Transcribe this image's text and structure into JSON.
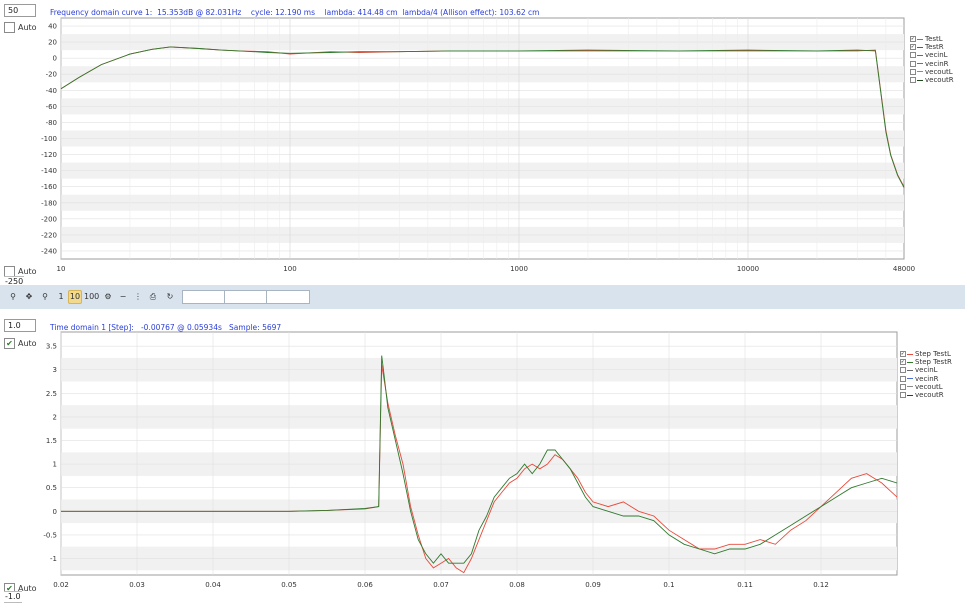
{
  "top": {
    "max_value": "50",
    "auto_label": "Auto",
    "auto_checked": false,
    "bottom_auto_label": "Auto",
    "bottom_auto_checked": false,
    "min_value": "-250",
    "title": "Frequency domain curve 1:  15.353dB @ 82.031Hz    cycle: 12.190 ms    lambda: 414.48 cm  lambda/4 (Allison effect): 103.62 cm"
  },
  "bottom": {
    "max_value": "1.0",
    "auto_label": "Auto",
    "auto_checked": true,
    "bottom_auto_label": "Auto",
    "bottom_auto_checked": true,
    "min_value": "-1.0",
    "title": "Time domain 1 [Step]:   -0.00767 @ 0.05934s   Sample: 5697"
  },
  "toolbar": {
    "buttons": [
      "zoom-in-icon",
      "pan-icon",
      "zoom-out-icon",
      "1",
      "10",
      "100",
      "settings-icon",
      "minus-icon",
      "bars-icon",
      "print-icon",
      "reset-icon"
    ],
    "selected": "10"
  },
  "colors": {
    "red": "#e84a3c",
    "green": "#2f7a2f",
    "title_blue": "#2b3fd8",
    "toolbar_bg": "#d9e3ee",
    "grid": "#dddddd",
    "band": "#f1f1f1"
  },
  "chart_data": [
    {
      "type": "line",
      "title": "Frequency domain curve 1:  15.353dB @ 82.031Hz    cycle: 12.190 ms    lambda: 414.48 cm  lambda/4 (Allison effect): 103.62 cm",
      "x_scale": "log",
      "xlim": [
        10,
        48000
      ],
      "ylim": [
        -250,
        50
      ],
      "x_ticks": [
        "10",
        "100",
        "1000",
        "10000",
        "48000"
      ],
      "y_ticks": [
        "40",
        "20",
        "0",
        "-20",
        "-40",
        "-60",
        "-80",
        "-100",
        "-120",
        "-140",
        "-160",
        "-180",
        "-200",
        "-220",
        "-240"
      ],
      "legend": [
        "TestL",
        "TestR",
        "vecinL",
        "vecinR",
        "vecoutL",
        "vecoutR"
      ],
      "legend_placement": "right",
      "series": [
        {
          "name": "TestL",
          "color": "#e84a3c",
          "x": [
            10,
            12,
            15,
            20,
            25,
            30,
            40,
            50,
            60,
            80,
            100,
            150,
            200,
            300,
            500,
            1000,
            2000,
            5000,
            10000,
            20000,
            30000,
            36000,
            40000,
            42000,
            45000,
            48000
          ],
          "y": [
            -38,
            -24,
            -8,
            5,
            11,
            14,
            12,
            10,
            9,
            8,
            5,
            8,
            7,
            8,
            9,
            9,
            9,
            9,
            9,
            9,
            9,
            10,
            -90,
            -120,
            -145,
            -160
          ]
        },
        {
          "name": "TestR",
          "color": "#2f7a2f",
          "x": [
            10,
            12,
            15,
            20,
            25,
            30,
            40,
            50,
            60,
            80,
            100,
            150,
            200,
            300,
            500,
            1000,
            2000,
            5000,
            10000,
            20000,
            30000,
            36000,
            40000,
            42000,
            45000,
            48000
          ],
          "y": [
            -38,
            -24,
            -8,
            5,
            11,
            14,
            12,
            10,
            9,
            7,
            6,
            7,
            8,
            8,
            9,
            9,
            10,
            9,
            10,
            9,
            10,
            9,
            -92,
            -121,
            -146,
            -161
          ]
        }
      ]
    },
    {
      "type": "line",
      "title": "Time domain 1 [Step]:   -0.00767 @ 0.05934s   Sample: 5697",
      "xlim": [
        0.02,
        0.13
      ],
      "ylim": [
        -1.35,
        3.8
      ],
      "x_ticks": [
        "0.02",
        "0.03",
        "0.04",
        "0.05",
        "0.06",
        "0.07",
        "0.08",
        "0.09",
        "0.1",
        "0.11",
        "0.12"
      ],
      "y_ticks": [
        "3.5",
        "3",
        "2.5",
        "2",
        "1.5",
        "1",
        "0.5",
        "0",
        "-0.5",
        "-1"
      ],
      "legend": [
        "Step TestL",
        "Step TestR",
        "vecinL",
        "vecinR",
        "vecoutL",
        "vecoutR"
      ],
      "legend_placement": "right",
      "series": [
        {
          "name": "Step TestL",
          "color": "#e84a3c",
          "x": [
            0.02,
            0.04,
            0.05,
            0.055,
            0.06,
            0.0618,
            0.0622,
            0.0625,
            0.063,
            0.064,
            0.065,
            0.066,
            0.067,
            0.068,
            0.069,
            0.07,
            0.071,
            0.072,
            0.073,
            0.074,
            0.075,
            0.076,
            0.077,
            0.078,
            0.079,
            0.08,
            0.081,
            0.082,
            0.083,
            0.084,
            0.085,
            0.086,
            0.087,
            0.088,
            0.089,
            0.09,
            0.092,
            0.094,
            0.096,
            0.098,
            0.1,
            0.102,
            0.104,
            0.106,
            0.108,
            0.11,
            0.112,
            0.114,
            0.116,
            0.118,
            0.12,
            0.122,
            0.124,
            0.126,
            0.128,
            0.13
          ],
          "y": [
            0,
            0,
            0.0,
            0.02,
            0.05,
            0.1,
            3.1,
            2.8,
            2.3,
            1.6,
            1.0,
            0.1,
            -0.5,
            -1.0,
            -1.2,
            -1.1,
            -1.0,
            -1.2,
            -1.3,
            -1.0,
            -0.6,
            -0.2,
            0.2,
            0.4,
            0.6,
            0.7,
            0.9,
            1.0,
            0.9,
            1.0,
            1.2,
            1.1,
            0.9,
            0.7,
            0.4,
            0.2,
            0.1,
            0.2,
            0.0,
            -0.1,
            -0.4,
            -0.6,
            -0.8,
            -0.8,
            -0.7,
            -0.7,
            -0.6,
            -0.7,
            -0.4,
            -0.2,
            0.1,
            0.4,
            0.7,
            0.8,
            0.6,
            0.3
          ]
        },
        {
          "name": "Step TestR",
          "color": "#2f7a2f",
          "x": [
            0.02,
            0.04,
            0.05,
            0.055,
            0.06,
            0.0618,
            0.0622,
            0.0625,
            0.063,
            0.064,
            0.065,
            0.066,
            0.067,
            0.068,
            0.069,
            0.07,
            0.071,
            0.072,
            0.073,
            0.074,
            0.075,
            0.076,
            0.077,
            0.078,
            0.079,
            0.08,
            0.081,
            0.082,
            0.083,
            0.084,
            0.085,
            0.086,
            0.087,
            0.088,
            0.089,
            0.09,
            0.092,
            0.094,
            0.096,
            0.098,
            0.1,
            0.102,
            0.104,
            0.106,
            0.108,
            0.11,
            0.112,
            0.114,
            0.116,
            0.118,
            0.12,
            0.122,
            0.124,
            0.126,
            0.128,
            0.13
          ],
          "y": [
            0,
            0,
            0.0,
            0.02,
            0.06,
            0.1,
            3.3,
            2.9,
            2.2,
            1.5,
            0.8,
            0.0,
            -0.6,
            -0.9,
            -1.1,
            -0.9,
            -1.1,
            -1.1,
            -1.1,
            -0.9,
            -0.4,
            -0.1,
            0.3,
            0.5,
            0.7,
            0.8,
            1.0,
            0.8,
            1.0,
            1.3,
            1.3,
            1.1,
            0.9,
            0.6,
            0.3,
            0.1,
            0.0,
            -0.1,
            -0.1,
            -0.2,
            -0.5,
            -0.7,
            -0.8,
            -0.9,
            -0.8,
            -0.8,
            -0.7,
            -0.5,
            -0.3,
            -0.1,
            0.1,
            0.3,
            0.5,
            0.6,
            0.7,
            0.6
          ]
        }
      ]
    }
  ]
}
